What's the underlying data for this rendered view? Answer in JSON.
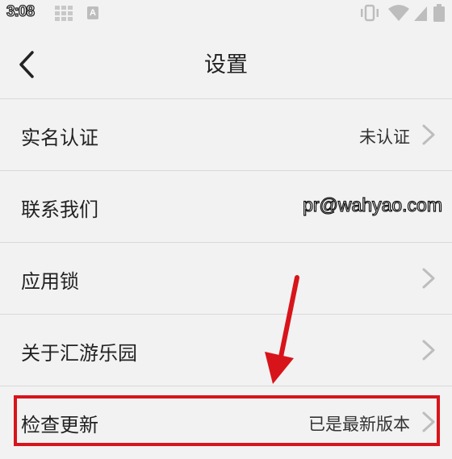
{
  "status_bar": {
    "time": "3:08",
    "icons": [
      "grid-icon",
      "a-notification-icon",
      "vibrate-icon",
      "wifi-icon",
      "signal-icon",
      "battery-icon"
    ]
  },
  "header": {
    "title": "设置",
    "back_icon": "chevron-left-icon"
  },
  "settings": {
    "items": [
      {
        "label": "实名认证",
        "value": "未认证",
        "chevron": true
      },
      {
        "label": "联系我们",
        "value": "pr@wahyao.com",
        "chevron": false
      },
      {
        "label": "应用锁",
        "value": "",
        "chevron": true
      },
      {
        "label": "关于汇游乐园",
        "value": "",
        "chevron": true
      },
      {
        "label": "检查更新",
        "value": "已是最新版本",
        "chevron": true
      }
    ]
  },
  "annotation": {
    "highlight_color": "#d8141b"
  },
  "colors": {
    "background": "#f2f2f2",
    "divider": "#d9d9d9",
    "chevron": "#bdbdbd"
  }
}
